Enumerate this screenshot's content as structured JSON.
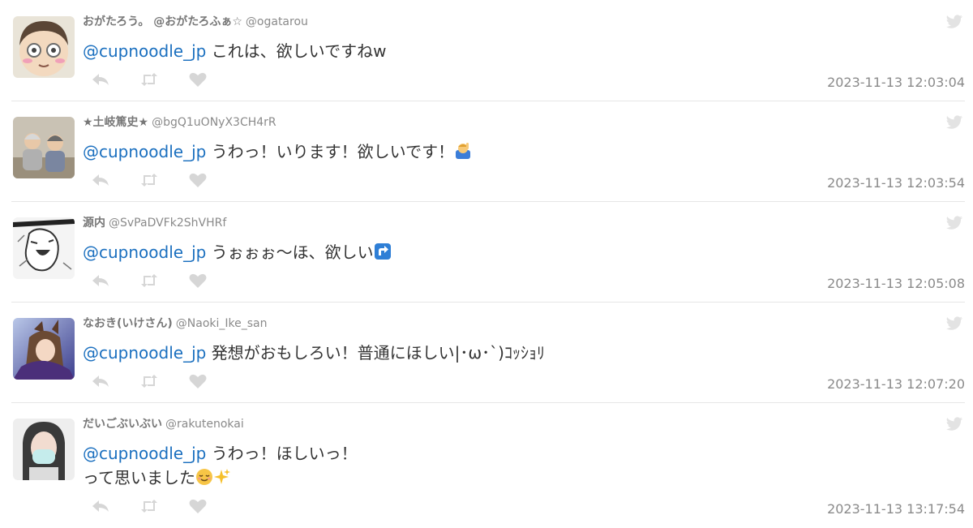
{
  "tweets": [
    {
      "name": "おがたろう。 @おがたろふぁ☆",
      "handle": "@ogatarou",
      "mention": "@cupnoodle_jp",
      "text": "これは、欲しいですねw",
      "text2": "",
      "timestamp": "2023-11-13 12:03:04"
    },
    {
      "name": "★土岐篤史★",
      "handle": "@bgQ1uONyX3CH4rR",
      "mention": "@cupnoodle_jp",
      "text": "うわっ！いります！欲しいです！",
      "text2": "",
      "timestamp": "2023-11-13 12:03:54"
    },
    {
      "name": "源内",
      "handle": "@SvPaDVFk2ShVHRf",
      "mention": "@cupnoodle_jp",
      "text": "うぉぉぉ〜ほ、欲しい",
      "text2": "",
      "timestamp": "2023-11-13 12:05:08"
    },
    {
      "name": "なおき(いけさん)",
      "handle": "@Naoki_Ike_san",
      "mention": "@cupnoodle_jp",
      "text": "発想がおもしろい！普通にほしい|･ω･`)ｺｯｼｮﾘ",
      "text2": "",
      "timestamp": "2023-11-13 12:07:20"
    },
    {
      "name": "だいごぶいぶい",
      "handle": "@rakutenokai",
      "mention": "@cupnoodle_jp",
      "text": "うわっ！ほしいっ！",
      "text2": "って思いました",
      "timestamp": "2023-11-13 13:17:54"
    }
  ],
  "icons": {
    "reply": "reply-icon",
    "retweet": "retweet-icon",
    "like": "heart-icon",
    "brand": "twitter-bird-icon"
  },
  "colors": {
    "mention": "#1a6fbf",
    "text": "#333333",
    "meta": "#8a8a8a",
    "action_icons": "#d6d6d6"
  }
}
